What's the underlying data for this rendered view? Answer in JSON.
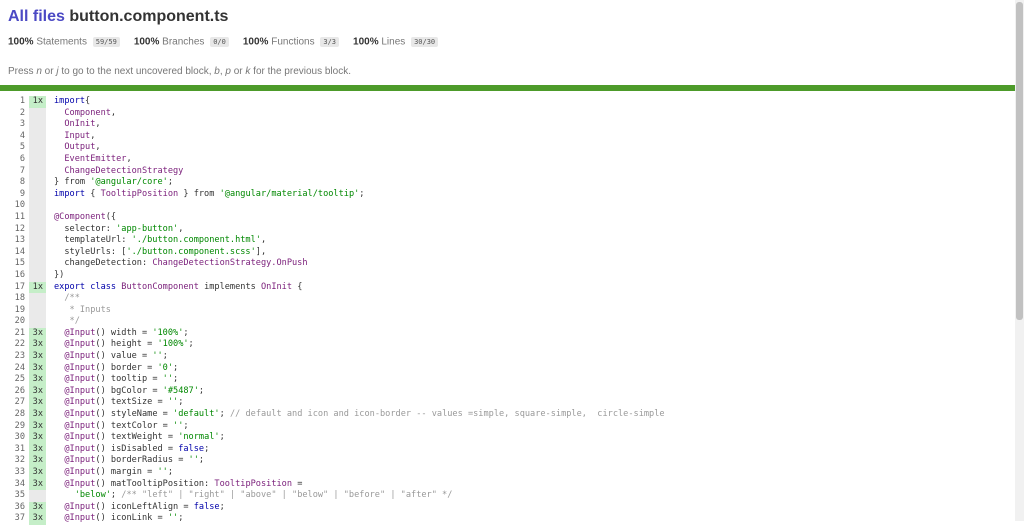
{
  "header": {
    "all_files_link": "All files",
    "file_name": "button.component.ts"
  },
  "summary": [
    {
      "pct": "100%",
      "label": "Statements",
      "fraction": "59/59"
    },
    {
      "pct": "100%",
      "label": "Branches",
      "fraction": "0/0"
    },
    {
      "pct": "100%",
      "label": "Functions",
      "fraction": "3/3"
    },
    {
      "pct": "100%",
      "label": "Lines",
      "fraction": "30/30"
    }
  ],
  "hint": {
    "p1": "Press ",
    "n": "n",
    "or1": " or ",
    "j": "j",
    "p2": " to go to the next uncovered block, ",
    "b": "b",
    "comma": ", ",
    "p": "p",
    "or2": " or ",
    "k": "k",
    "p3": " for the previous block."
  },
  "colors": {
    "accent": "#4b49c4",
    "status": "#4d9b2a",
    "hit": "#c5eec8"
  },
  "code_lines": [
    {
      "n": "1",
      "c": "1x",
      "t": "hit",
      "s": [
        [
          "kw",
          "import"
        ],
        [
          "",
          "{"
        ]
      ]
    },
    {
      "n": "2",
      "c": "",
      "t": "neutral",
      "s": [
        [
          "pn",
          "  Component"
        ],
        [
          "",
          ","
        ]
      ]
    },
    {
      "n": "3",
      "c": "",
      "t": "neutral",
      "s": [
        [
          "pn",
          "  OnInit"
        ],
        [
          "",
          ","
        ]
      ]
    },
    {
      "n": "4",
      "c": "",
      "t": "neutral",
      "s": [
        [
          "pn",
          "  Input"
        ],
        [
          "",
          ","
        ]
      ]
    },
    {
      "n": "5",
      "c": "",
      "t": "neutral",
      "s": [
        [
          "pn",
          "  Output"
        ],
        [
          "",
          ","
        ]
      ]
    },
    {
      "n": "6",
      "c": "",
      "t": "neutral",
      "s": [
        [
          "pn",
          "  EventEmitter"
        ],
        [
          "",
          ","
        ]
      ]
    },
    {
      "n": "7",
      "c": "",
      "t": "neutral",
      "s": [
        [
          "pn",
          "  ChangeDetectionStrategy"
        ]
      ]
    },
    {
      "n": "8",
      "c": "",
      "t": "neutral",
      "s": [
        [
          "",
          "} from "
        ],
        [
          "str",
          "'@angular/core'"
        ],
        [
          "",
          ";"
        ]
      ]
    },
    {
      "n": "9",
      "c": "",
      "t": "neutral",
      "s": [
        [
          "kw",
          "import"
        ],
        [
          "",
          " { "
        ],
        [
          "pn",
          "TooltipPosition"
        ],
        [
          "",
          " } from "
        ],
        [
          "str",
          "'@angular/material/tooltip'"
        ],
        [
          "",
          ";"
        ]
      ]
    },
    {
      "n": "10",
      "c": "",
      "t": "neutral",
      "s": [
        [
          "",
          ""
        ]
      ]
    },
    {
      "n": "11",
      "c": "",
      "t": "neutral",
      "s": [
        [
          "pn",
          "@Component"
        ],
        [
          "",
          "({"
        ]
      ]
    },
    {
      "n": "12",
      "c": "",
      "t": "neutral",
      "s": [
        [
          "",
          "  selector: "
        ],
        [
          "str",
          "'app-button'"
        ],
        [
          "",
          ","
        ]
      ]
    },
    {
      "n": "13",
      "c": "",
      "t": "neutral",
      "s": [
        [
          "",
          "  templateUrl: "
        ],
        [
          "str",
          "'./button.component.html'"
        ],
        [
          "",
          ","
        ]
      ]
    },
    {
      "n": "14",
      "c": "",
      "t": "neutral",
      "s": [
        [
          "",
          "  styleUrls: ["
        ],
        [
          "str",
          "'./button.component.scss'"
        ],
        [
          "",
          "],"
        ]
      ]
    },
    {
      "n": "15",
      "c": "",
      "t": "neutral",
      "s": [
        [
          "",
          "  changeDetection: "
        ],
        [
          "pn",
          "ChangeDetectionStrategy.OnPush"
        ]
      ]
    },
    {
      "n": "16",
      "c": "",
      "t": "neutral",
      "s": [
        [
          "",
          "})"
        ]
      ]
    },
    {
      "n": "17",
      "c": "1x",
      "t": "hit",
      "s": [
        [
          "kw",
          "export class"
        ],
        [
          "",
          " "
        ],
        [
          "pn",
          "ButtonComponent"
        ],
        [
          "",
          " implements "
        ],
        [
          "pn",
          "OnInit"
        ],
        [
          "",
          " {"
        ]
      ]
    },
    {
      "n": "18",
      "c": "",
      "t": "neutral",
      "s": [
        [
          "com",
          "  /**"
        ]
      ]
    },
    {
      "n": "19",
      "c": "",
      "t": "neutral",
      "s": [
        [
          "com",
          "   * Inputs"
        ]
      ]
    },
    {
      "n": "20",
      "c": "",
      "t": "neutral",
      "s": [
        [
          "com",
          "   */"
        ]
      ]
    },
    {
      "n": "21",
      "c": "3x",
      "t": "hit",
      "s": [
        [
          "pn",
          "  @Input"
        ],
        [
          "",
          "() width = "
        ],
        [
          "str",
          "'100%'"
        ],
        [
          "",
          ";"
        ]
      ]
    },
    {
      "n": "22",
      "c": "3x",
      "t": "hit",
      "s": [
        [
          "pn",
          "  @Input"
        ],
        [
          "",
          "() height = "
        ],
        [
          "str",
          "'100%'"
        ],
        [
          "",
          ";"
        ]
      ]
    },
    {
      "n": "23",
      "c": "3x",
      "t": "hit",
      "s": [
        [
          "pn",
          "  @Input"
        ],
        [
          "",
          "() value = "
        ],
        [
          "str",
          "''"
        ],
        [
          "",
          ";"
        ]
      ]
    },
    {
      "n": "24",
      "c": "3x",
      "t": "hit",
      "s": [
        [
          "pn",
          "  @Input"
        ],
        [
          "",
          "() border = "
        ],
        [
          "str",
          "'0'"
        ],
        [
          "",
          ";"
        ]
      ]
    },
    {
      "n": "25",
      "c": "3x",
      "t": "hit",
      "s": [
        [
          "pn",
          "  @Input"
        ],
        [
          "",
          "() tooltip = "
        ],
        [
          "str",
          "''"
        ],
        [
          "",
          ";"
        ]
      ]
    },
    {
      "n": "26",
      "c": "3x",
      "t": "hit",
      "s": [
        [
          "pn",
          "  @Input"
        ],
        [
          "",
          "() bgColor = "
        ],
        [
          "str",
          "'#5487'"
        ],
        [
          "",
          ";"
        ]
      ]
    },
    {
      "n": "27",
      "c": "3x",
      "t": "hit",
      "s": [
        [
          "pn",
          "  @Input"
        ],
        [
          "",
          "() textSize = "
        ],
        [
          "str",
          "''"
        ],
        [
          "",
          ";"
        ]
      ]
    },
    {
      "n": "28",
      "c": "3x",
      "t": "hit",
      "s": [
        [
          "pn",
          "  @Input"
        ],
        [
          "",
          "() styleName = "
        ],
        [
          "str",
          "'default'"
        ],
        [
          "",
          "; "
        ],
        [
          "com",
          "// default and icon and icon-border -- values =simple, square-simple,  circle-simple"
        ]
      ]
    },
    {
      "n": "29",
      "c": "3x",
      "t": "hit",
      "s": [
        [
          "pn",
          "  @Input"
        ],
        [
          "",
          "() textColor = "
        ],
        [
          "str",
          "''"
        ],
        [
          "",
          ";"
        ]
      ]
    },
    {
      "n": "30",
      "c": "3x",
      "t": "hit",
      "s": [
        [
          "pn",
          "  @Input"
        ],
        [
          "",
          "() textWeight = "
        ],
        [
          "str",
          "'normal'"
        ],
        [
          "",
          ";"
        ]
      ]
    },
    {
      "n": "31",
      "c": "3x",
      "t": "hit",
      "s": [
        [
          "pn",
          "  @Input"
        ],
        [
          "",
          "() isDisabled = "
        ],
        [
          "kw",
          "false"
        ],
        [
          "",
          ";"
        ]
      ]
    },
    {
      "n": "32",
      "c": "3x",
      "t": "hit",
      "s": [
        [
          "pn",
          "  @Input"
        ],
        [
          "",
          "() borderRadius = "
        ],
        [
          "str",
          "''"
        ],
        [
          "",
          ";"
        ]
      ]
    },
    {
      "n": "33",
      "c": "3x",
      "t": "hit",
      "s": [
        [
          "pn",
          "  @Input"
        ],
        [
          "",
          "() margin = "
        ],
        [
          "str",
          "''"
        ],
        [
          "",
          ";"
        ]
      ]
    },
    {
      "n": "34",
      "c": "3x",
      "t": "hit",
      "s": [
        [
          "pn",
          "  @Input"
        ],
        [
          "",
          "() matTooltipPosition: "
        ],
        [
          "pn",
          "TooltipPosition"
        ],
        [
          "",
          " ="
        ]
      ]
    },
    {
      "n": "35",
      "c": "",
      "t": "neutral",
      "s": [
        [
          "str",
          "    'below'"
        ],
        [
          "",
          "; "
        ],
        [
          "com",
          "/** \"left\" | \"right\" | \"above\" | \"below\" | \"before\" | \"after\" */"
        ]
      ]
    },
    {
      "n": "36",
      "c": "3x",
      "t": "hit",
      "s": [
        [
          "pn",
          "  @Input"
        ],
        [
          "",
          "() iconLeftAlign = "
        ],
        [
          "kw",
          "false"
        ],
        [
          "",
          ";"
        ]
      ]
    },
    {
      "n": "37",
      "c": "3x",
      "t": "hit",
      "s": [
        [
          "pn",
          "  @Input"
        ],
        [
          "",
          "() iconLink = "
        ],
        [
          "str",
          "''"
        ],
        [
          "",
          ";"
        ]
      ]
    }
  ]
}
